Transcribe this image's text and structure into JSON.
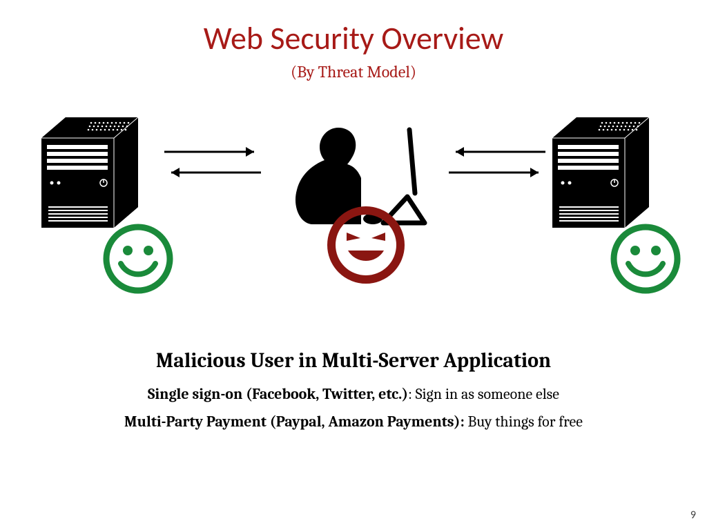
{
  "title": "Web Security Overview",
  "subtitle": "(By Threat Model)",
  "heading": "Malicious User in Multi-Server Application",
  "line1_bold": "Single sign-on (Facebook, Twitter, etc.)",
  "line1_rest": ": Sign in as someone else",
  "line2_bold": "Multi-Party Payment (Paypal, Amazon Payments):",
  "line2_rest": " Buy things for free",
  "page": "9",
  "colors": {
    "accent": "#a71a17",
    "good": "#1a8a3a",
    "evil": "#8a1611"
  }
}
